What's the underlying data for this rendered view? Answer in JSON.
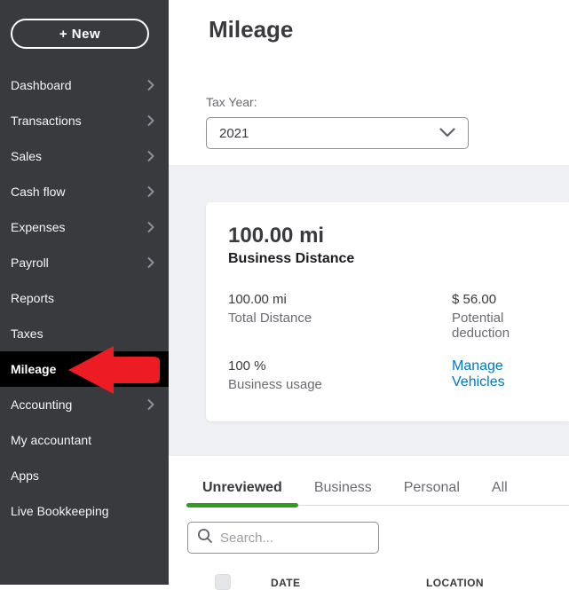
{
  "sidebar": {
    "new_button_label": "+ New",
    "items": [
      {
        "label": "Dashboard",
        "chevron": true
      },
      {
        "label": "Transactions",
        "chevron": true
      },
      {
        "label": "Sales",
        "chevron": true
      },
      {
        "label": "Cash flow",
        "chevron": true
      },
      {
        "label": "Expenses",
        "chevron": true
      },
      {
        "label": "Payroll",
        "chevron": true
      },
      {
        "label": "Reports",
        "chevron": false
      },
      {
        "label": "Taxes",
        "chevron": false
      },
      {
        "label": "Mileage",
        "chevron": false,
        "active": true
      },
      {
        "label": "Accounting",
        "chevron": true
      },
      {
        "label": "My accountant",
        "chevron": false
      },
      {
        "label": "Apps",
        "chevron": false
      },
      {
        "label": "Live Bookkeeping",
        "chevron": false
      }
    ]
  },
  "header": {
    "title": "Mileage"
  },
  "tax_year": {
    "label": "Tax Year:",
    "value": "2021"
  },
  "summary_card": {
    "primary_value": "100.00 mi",
    "primary_label": "Business Distance",
    "stats": [
      {
        "value": "100.00 mi",
        "label": "Total Distance"
      },
      {
        "value": "$ 56.00",
        "label": "Potential deduction"
      },
      {
        "value": "100 %",
        "label": "Business usage"
      }
    ],
    "link_label": "Manage Vehicles"
  },
  "tabs": [
    {
      "label": "Unreviewed",
      "active": true
    },
    {
      "label": "Business",
      "active": false
    },
    {
      "label": "Personal",
      "active": false
    },
    {
      "label": "All",
      "active": false
    }
  ],
  "search": {
    "placeholder": "Search..."
  },
  "table": {
    "columns": [
      "DATE",
      "LOCATION"
    ]
  },
  "annotations": {
    "arrow": "red-arrow-pointing-at-mileage"
  },
  "colors": {
    "sidebar_bg": "#393a3d",
    "active_item_bg": "#000000",
    "accent_green": "#2ca01c",
    "link_blue": "#0077c5",
    "arrow_red": "#ed1c24",
    "band_gray": "#eef0f4"
  }
}
